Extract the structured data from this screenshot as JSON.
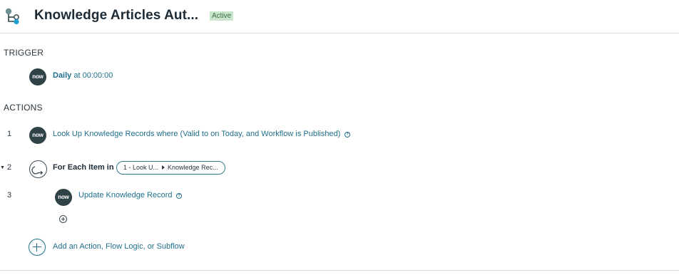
{
  "header": {
    "title": "Knowledge Articles Aut...",
    "status_badge": "Active"
  },
  "colors": {
    "accent": "#1f6f8b",
    "avatar_bg": "#2f4246",
    "badge_bg": "#c9e6cc",
    "badge_text": "#3d6e43",
    "pill_border": "#2d7d86"
  },
  "trigger": {
    "heading": "TRIGGER",
    "avatar_text": "now",
    "frequency": "Daily",
    "time_text": " at 00:00:00"
  },
  "actions": {
    "heading": "ACTIONS",
    "steps": [
      {
        "number": "1",
        "avatar_text": "now",
        "label": "Look Up Knowledge Records where (Valid to on Today, and Workflow is Published)",
        "icon": "help-icon"
      },
      {
        "number": "2",
        "expand_icon": "caret-down-icon",
        "icon": "for-each-icon",
        "label": "For Each Item in",
        "pill_source": "1 - Look U...",
        "pill_target": "Knowledge Rec..."
      },
      {
        "number": "3",
        "avatar_text": "now",
        "label": "Update Knowledge Record",
        "icon": "help-icon"
      }
    ],
    "add_label": "Add an Action, Flow Logic, or Subflow"
  }
}
